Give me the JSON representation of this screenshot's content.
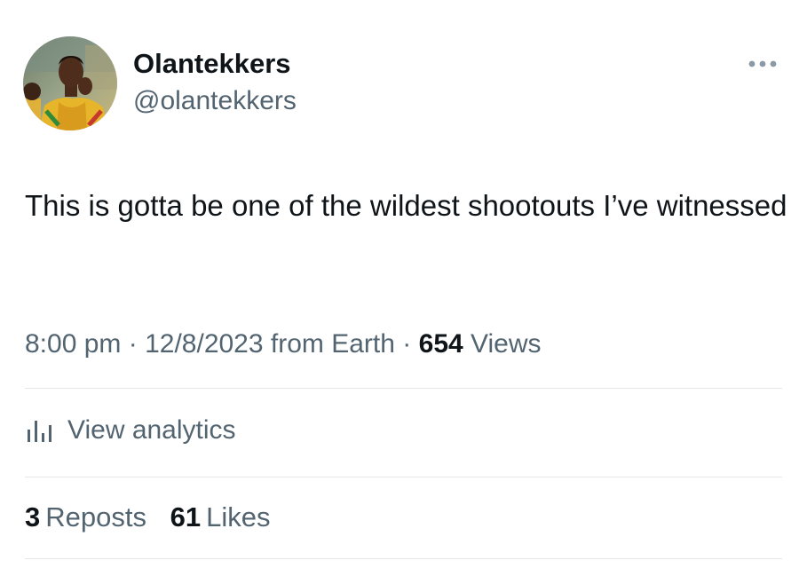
{
  "author": {
    "display_name": "Olantekkers",
    "handle": "@olantekkers",
    "avatar_icon": "avatar-photo"
  },
  "tweet": {
    "text": "This is gotta be one of the wildest shootouts I’ve witnessed"
  },
  "meta": {
    "time": "8:00 pm",
    "separator": "·",
    "date": "12/8/2023",
    "source": "from Earth",
    "views_count": "654",
    "views_label": "Views"
  },
  "analytics": {
    "label": "View analytics",
    "icon": "bar-chart-icon"
  },
  "stats": {
    "reposts_count": "3",
    "reposts_label": "Reposts",
    "likes_count": "61",
    "likes_label": "Likes"
  },
  "colors": {
    "text_primary": "#0f1419",
    "text_secondary": "#536471",
    "divider": "#e4e8eb",
    "background": "#ffffff"
  }
}
